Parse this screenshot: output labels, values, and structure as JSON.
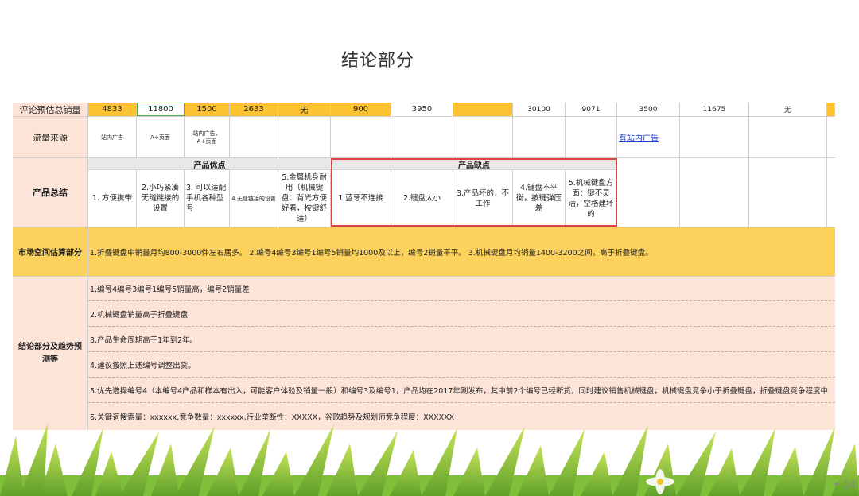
{
  "slide": {
    "title": "结论部分",
    "page_number": "• 14"
  },
  "table": {
    "row1": {
      "label": "评论预估总销量",
      "values": [
        "4833",
        "11800",
        "1500",
        "2633",
        "无",
        "900",
        "3950",
        "",
        "30100",
        "9071",
        "3500",
        "11675",
        "无"
      ]
    },
    "row2": {
      "label": "流量来源",
      "values": [
        "站内广告",
        "A+页面",
        "站内广告，A+页面",
        "",
        "",
        "",
        "",
        "",
        "",
        "",
        "有站内广告"
      ]
    },
    "row3": {
      "label": "产品总结",
      "advantages_header": "产品优点",
      "disadvantages_header": "产品缺点",
      "advantages": [
        "1. 方便携带",
        "2.小巧紧凑无缝链接的设置",
        "3. 可以适配手机各种型号",
        "4.无缝链接的设置",
        "5.金属机身耐用（机械键盘：背光方便好看，按键舒适）"
      ],
      "disadvantages": [
        "1.蓝牙不连接",
        "2.键盘太小",
        "3.产品坏的，不工作",
        "4.键盘不平衡，按键弹压差",
        "5.机械键盘方面：键不灵活，空格建坏的"
      ]
    },
    "row4": {
      "label": "市场空间估算部分",
      "text": "1.折叠键盘中销量月均800-3000件左右居多。   2.编号4编号3编号1编号5销量均1000及以上，编号2销量平平。    3.机械键盘月均销量1400-3200之间，高于折叠键盘。"
    },
    "row5": {
      "label": "结论部分及趋势预测等",
      "lines": [
        "1.编号4编号3编号1编号5销量高，编号2销量差",
        "2.机械键盘销量高于折叠键盘",
        "3.产品生命周期高于1年到2年。",
        "4.建议按照上述编号调整出货。",
        "5.优先选择编号4（本编号4产品和样本有出入，可能客户体验及销量一般）和编号3及编号1，产品均在2017年刚发布，其中前2个编号已经断货，同时建议销售机械键盘，机械键盘竞争小于折叠键盘，折叠键盘竞争程度中",
        "6.关键词搜索量：xxxxxx,竞争数量：xxxxxx,行业垄断性：XXXXX，谷歌趋势及规划师竞争程度：XXXXXX"
      ]
    }
  },
  "colors": {
    "header_bg": "#fde4d9",
    "highlight_orange": "#fdc232",
    "market_yellow": "#fcd15c",
    "red_border": "#d64545"
  }
}
